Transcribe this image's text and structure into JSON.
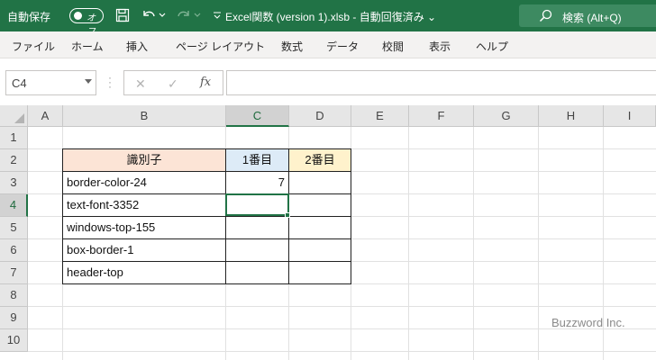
{
  "titlebar": {
    "autosave_label": "自動保存",
    "autosave_state": "オフ",
    "doc_title": "Excel関数 (version 1).xlsb  -  自動回復済み  ⌄",
    "search_label": "検索 (Alt+Q)"
  },
  "menu": [
    "ファイル",
    "ホーム",
    "挿入",
    "ページ レイアウト",
    "数式",
    "データ",
    "校閲",
    "表示",
    "ヘルプ"
  ],
  "formula_bar": {
    "name_box": "C4",
    "cancel": "✕",
    "enter": "✓",
    "fx": "fx",
    "formula": ""
  },
  "sheet": {
    "columns": [
      "A",
      "B",
      "C",
      "D",
      "E",
      "F",
      "G",
      "H",
      "I"
    ],
    "active_column": "C",
    "rows": [
      "1",
      "2",
      "3",
      "4",
      "5",
      "6",
      "7",
      "8",
      "9",
      "10"
    ],
    "active_row": "4",
    "active_cell": "C4",
    "table": {
      "headers": [
        "識別子",
        "1番目",
        "2番目"
      ],
      "header_colors": [
        "#fce4d6",
        "#ddebf7",
        "#fff2cc"
      ],
      "rows": [
        [
          "border-color-24",
          "7",
          ""
        ],
        [
          "text-font-3352",
          "",
          ""
        ],
        [
          "windows-top-155",
          "",
          ""
        ],
        [
          "box-border-1",
          "",
          ""
        ],
        [
          "header-top",
          "",
          ""
        ]
      ]
    }
  },
  "watermark": "Buzzword Inc.",
  "colors": {
    "accent": "#217346",
    "ribbon_bg": "#f3f2f1"
  }
}
